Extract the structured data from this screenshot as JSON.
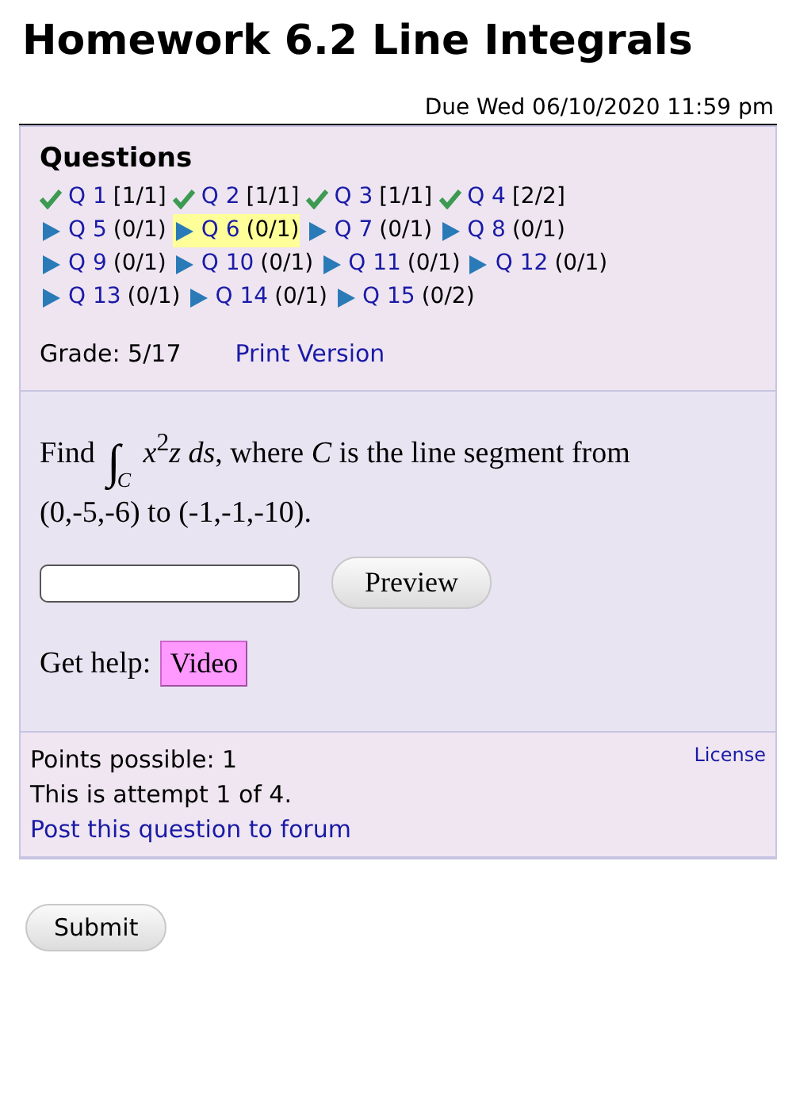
{
  "title": "Homework 6.2 Line Integrals",
  "due": "Due Wed 06/10/2020 11:59 pm",
  "questions_panel": {
    "heading": "Questions",
    "questions": [
      {
        "kind": "done",
        "label": "Q 1",
        "score": "[1/1]",
        "selected": false
      },
      {
        "kind": "done",
        "label": "Q 2",
        "score": "[1/1]",
        "selected": false
      },
      {
        "kind": "done",
        "label": "Q 3",
        "score": "[1/1]",
        "selected": false
      },
      {
        "kind": "done",
        "label": "Q 4",
        "score": "[2/2]",
        "selected": false
      },
      {
        "kind": "todo",
        "label": "Q 5",
        "score": "(0/1)",
        "selected": false
      },
      {
        "kind": "todo",
        "label": "Q 6",
        "score": "(0/1)",
        "selected": true
      },
      {
        "kind": "todo",
        "label": "Q 7",
        "score": "(0/1)",
        "selected": false
      },
      {
        "kind": "todo",
        "label": "Q 8",
        "score": "(0/1)",
        "selected": false
      },
      {
        "kind": "todo",
        "label": "Q 9",
        "score": "(0/1)",
        "selected": false
      },
      {
        "kind": "todo",
        "label": "Q 10",
        "score": "(0/1)",
        "selected": false
      },
      {
        "kind": "todo",
        "label": "Q 11",
        "score": "(0/1)",
        "selected": false
      },
      {
        "kind": "todo",
        "label": "Q 12",
        "score": "(0/1)",
        "selected": false
      },
      {
        "kind": "todo",
        "label": "Q 13",
        "score": "(0/1)",
        "selected": false
      },
      {
        "kind": "todo",
        "label": "Q 14",
        "score": "(0/1)",
        "selected": false
      },
      {
        "kind": "todo",
        "label": "Q 15",
        "score": "(0/2)",
        "selected": false
      }
    ],
    "grade": "Grade: 5/17",
    "print_link": "Print Version"
  },
  "question": {
    "prefix": "Find",
    "integral": "∫",
    "subscript": "C",
    "integrand": "*x*$^{2}$*z ds*",
    "rest": ", where *C* is the line segment from (0,-5,-6) to (-1,-1,-10).",
    "preview_button": "Preview",
    "help_label": "Get help:",
    "video_button": "Video"
  },
  "info": {
    "points": "Points possible: 1",
    "attempt": "This is attempt 1 of 4.",
    "forum_link": "Post this question to forum",
    "license_link": "License"
  },
  "submit_button": "Submit"
}
